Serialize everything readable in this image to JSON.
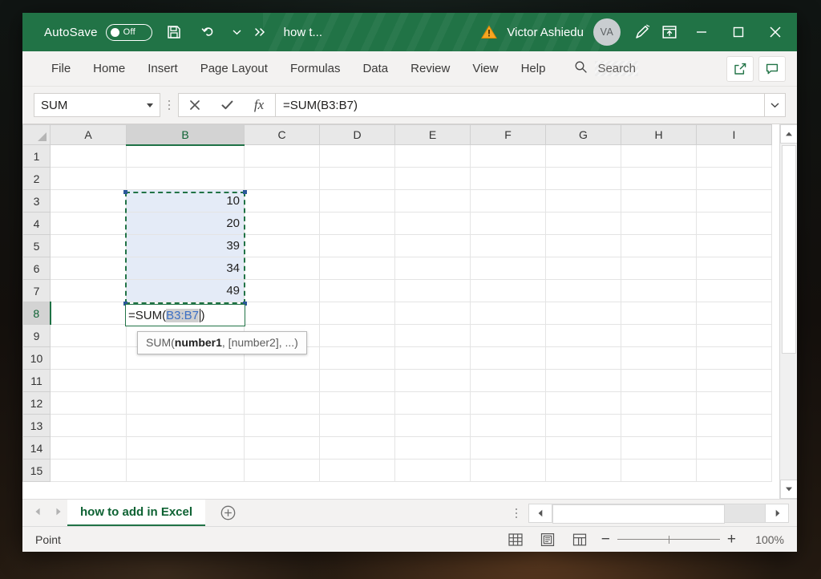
{
  "titlebar": {
    "autosave_label": "AutoSave",
    "autosave_state": "Off",
    "save_icon": "save-icon",
    "undo_icon": "undo-icon",
    "undo_caret_icon": "chevron-down-icon",
    "more_icon": "chevrons-right-icon",
    "document_title": "how t...",
    "warning_icon": "warning-icon",
    "user_name": "Victor Ashiedu",
    "avatar_initials": "VA",
    "pen_icon": "pen-annotate-icon",
    "ribbon_display_icon": "ribbon-display-options-icon",
    "minimize_icon": "minimize-icon",
    "maximize_icon": "maximize-icon",
    "close_icon": "close-icon",
    "bg_color": "#217346"
  },
  "ribbon": {
    "tabs": [
      {
        "label": "File"
      },
      {
        "label": "Home"
      },
      {
        "label": "Insert"
      },
      {
        "label": "Page Layout"
      },
      {
        "label": "Formulas"
      },
      {
        "label": "Data"
      },
      {
        "label": "Review"
      },
      {
        "label": "View"
      },
      {
        "label": "Help"
      }
    ],
    "search_label": "Search",
    "search_icon": "search-icon",
    "share_icon": "share-icon",
    "comments_icon": "comment-icon"
  },
  "formulabar": {
    "name_box_value": "SUM",
    "name_box_caret_icon": "chevron-down-icon",
    "cancel_icon": "cancel-x-icon",
    "enter_icon": "enter-check-icon",
    "fx_label": "fx",
    "formula_value": "=SUM(B3:B7)",
    "expand_icon": "chevron-down-icon"
  },
  "grid": {
    "columns": [
      "A",
      "B",
      "C",
      "D",
      "E",
      "F",
      "G",
      "H",
      "I"
    ],
    "active_column": "B",
    "rows": [
      "1",
      "2",
      "3",
      "4",
      "5",
      "6",
      "7",
      "8",
      "9",
      "10",
      "11",
      "12",
      "13",
      "14",
      "15"
    ],
    "active_row": "8",
    "cells": {
      "B3": "10",
      "B4": "20",
      "B5": "39",
      "B6": "34",
      "B7": "49"
    },
    "selection_range": "B3:B7",
    "selection_fill": "#e4ebf7",
    "edit_cell": {
      "address": "B8",
      "prefix": "=SUM(",
      "reference": "B3:B7",
      "suffix": ")"
    },
    "tooltip": {
      "prefix": "SUM(",
      "bold_arg": "number1",
      "rest": ", [number2], ...)"
    }
  },
  "tabbar": {
    "prev_icon": "arrow-left-icon",
    "next_icon": "arrow-right-icon",
    "sheets": [
      {
        "name": "how to add in Excel",
        "active": true
      }
    ],
    "add_sheet_icon": "plus-circle-icon",
    "scroll_left_icon": "arrow-left-icon",
    "scroll_right_icon": "arrow-right-icon"
  },
  "statusbar": {
    "mode": "Point",
    "normal_view_icon": "normal-view-icon",
    "page_layout_icon": "page-layout-view-icon",
    "page_break_icon": "page-break-view-icon",
    "zoom_out_icon": "zoom-out-icon",
    "zoom_in_icon": "zoom-in-icon",
    "zoom_level": "100%"
  }
}
